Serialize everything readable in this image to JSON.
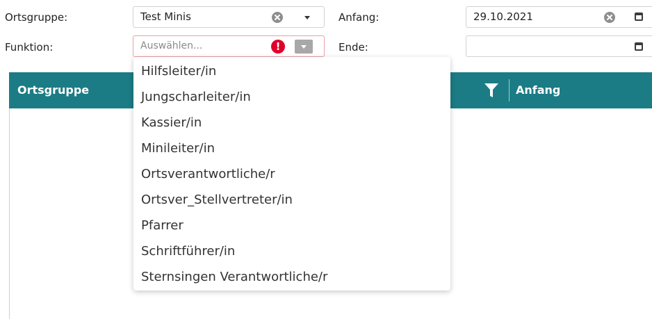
{
  "form": {
    "ortsgruppe_label": "Ortsgruppe:",
    "ortsgruppe_value": "Test Minis",
    "funktion_label": "Funktion:",
    "funktion_placeholder": "Auswählen...",
    "funktion_error_mark": "!",
    "anfang_label": "Anfang:",
    "anfang_value": "29.10.2021",
    "ende_label": "Ende:",
    "ende_value": ""
  },
  "grid": {
    "columns": [
      "Ortsgruppe",
      "Anfang"
    ]
  },
  "dropdown": {
    "items": [
      "Hilfsleiter/in",
      "Jungscharleiter/in",
      "Kassier/in",
      "Minileiter/in",
      "Ortsverantwortliche/r",
      "Ortsver_Stellvertreter/in",
      "Pfarrer",
      "Schriftführer/in",
      "Sternsingen Verantwortliche/r"
    ]
  },
  "colors": {
    "header_bg": "#1b7c85",
    "error_red": "#e0002a",
    "invalid_border": "#e8a0a8"
  },
  "icons": [
    "clear-icon",
    "chevron-down-icon",
    "calendar-icon",
    "error-icon",
    "filter-icon"
  ]
}
